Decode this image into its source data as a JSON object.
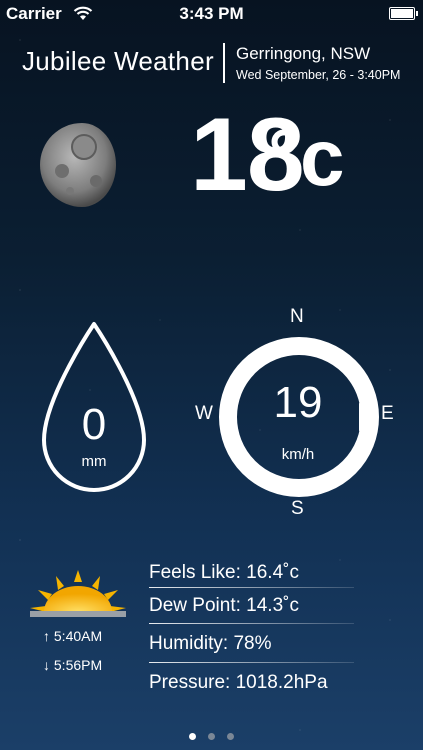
{
  "status_bar": {
    "carrier": "Carrier",
    "time": "3:43 PM"
  },
  "header": {
    "app_title": "Jubilee Weather",
    "location": "Gerringong, NSW",
    "datetime": "Wed September, 26 - 3:40PM"
  },
  "current": {
    "temperature": "18",
    "unit": "°c",
    "condition_icon": "moon-icon"
  },
  "rain": {
    "value": "0",
    "unit": "mm"
  },
  "wind": {
    "speed": "19",
    "unit": "km/h",
    "compass": {
      "n": "N",
      "s": "S",
      "w": "W",
      "e": "E"
    },
    "direction_icon": "east-pointer-icon"
  },
  "sun": {
    "sunrise": "↑ 5:40AM",
    "sunset": "↓ 5:56PM",
    "icon": "sunset-icon"
  },
  "details": {
    "feels_like": "Feels Like: 16.4˚c",
    "dew_point": "Dew Point: 14.3˚c",
    "humidity": "Humidity: 78%",
    "pressure": "Pressure: 1018.2hPa"
  },
  "pager": {
    "page_count": 3,
    "active_page": 1
  },
  "colors": {
    "text": "#ffffff",
    "background_top": "#071321",
    "background_bottom": "#1b3f68",
    "accent_sun": "#f5b400"
  }
}
